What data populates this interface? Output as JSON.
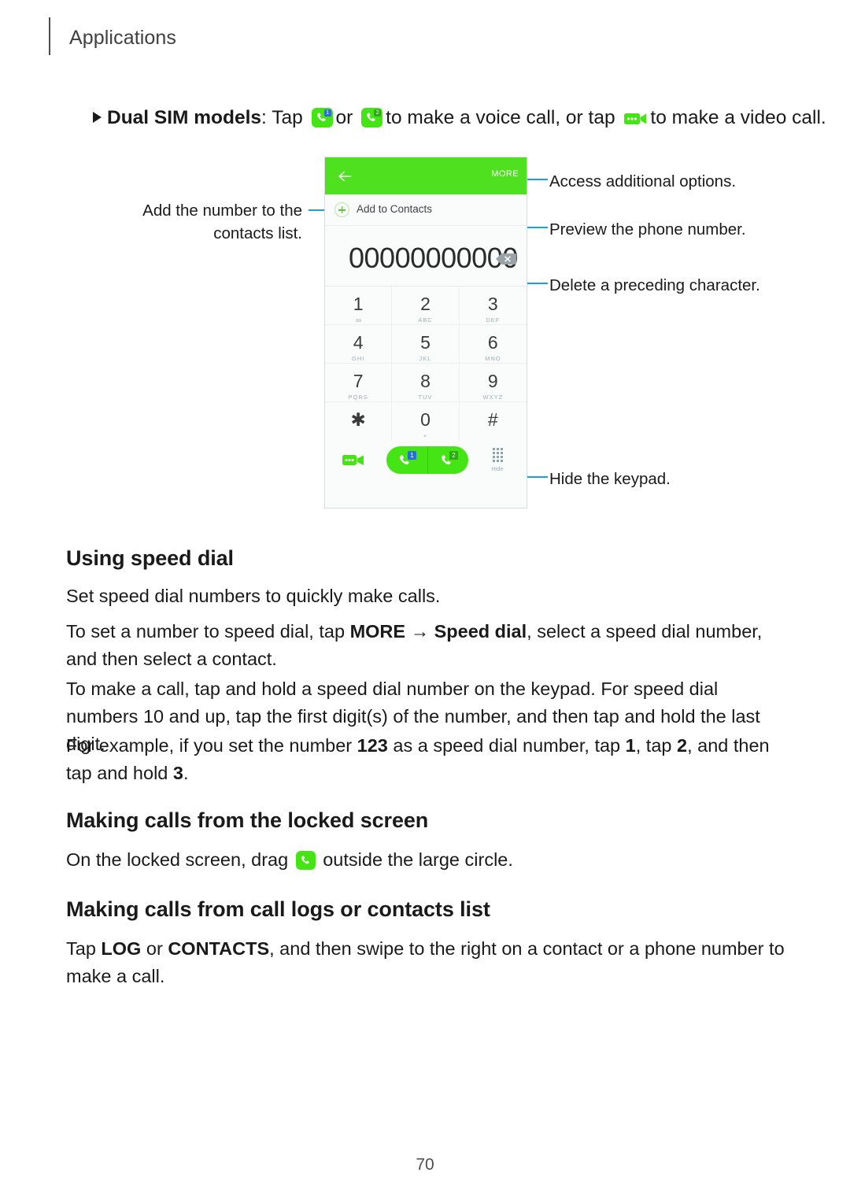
{
  "header": {
    "title": "Applications"
  },
  "bullet": {
    "marker": "▶",
    "lead_bold": "Dual SIM models",
    "part1": ": Tap",
    "part2": "or",
    "part3": "to make a voice call, or tap",
    "part4": "to make a video call.",
    "icons": [
      "phone-sim1-icon",
      "phone-sim2-icon",
      "video-call-icon"
    ]
  },
  "annotations": {
    "add_contacts": "Add the number to the contacts list.",
    "more": "Access additional options.",
    "preview": "Preview the phone number.",
    "delete": "Delete a preceding character.",
    "hide": "Hide the keypad.",
    "leader_color": "#1e9fd8"
  },
  "phone": {
    "accent_green": "#4fe01f",
    "topbar": {
      "back_icon": "arrow-left-icon",
      "more_label": "MORE"
    },
    "add_to_contacts": {
      "icon": "plus-circle-icon",
      "label": "Add to Contacts"
    },
    "number_field": {
      "value": "00000000000",
      "delete_icon": "backspace-icon"
    },
    "keypad": [
      {
        "digit": "1",
        "letters": "",
        "voicemail": "∞"
      },
      {
        "digit": "2",
        "letters": "ABC"
      },
      {
        "digit": "3",
        "letters": "DEF"
      },
      {
        "digit": "4",
        "letters": "GHI"
      },
      {
        "digit": "5",
        "letters": "JKL"
      },
      {
        "digit": "6",
        "letters": "MNO"
      },
      {
        "digit": "7",
        "letters": "PQRS"
      },
      {
        "digit": "8",
        "letters": "TUV"
      },
      {
        "digit": "9",
        "letters": "WXYZ"
      },
      {
        "digit": "✱",
        "letters": ""
      },
      {
        "digit": "0",
        "letters": "+"
      },
      {
        "digit": "#",
        "letters": ""
      }
    ],
    "actions": {
      "video_icon": "video-call-icon",
      "call_sim1_badge": "1",
      "call_sim2_badge": "2",
      "hide_icon": "keypad-grid-icon",
      "hide_label": "Hide"
    }
  },
  "sections": [
    {
      "heading": "Using speed dial",
      "paragraphs": [
        "Set speed dial numbers to quickly make calls.",
        "To set a number to speed dial, tap MORE → Speed dial, select a speed dial number, and then select a contact.",
        "To make a call, tap and hold a speed dial number on the keypad. For speed dial numbers 10 and up, tap the first digit(s) of the number, and then tap and hold the last digit.",
        "For example, if you set the number 123 as a speed dial number, tap 1, tap 2, and then tap and hold 3."
      ]
    },
    {
      "heading": "Making calls from the locked screen",
      "paragraphs": [
        "On the locked screen, drag   outside the large circle."
      ]
    },
    {
      "heading": "Making calls from call logs or contacts list",
      "paragraphs": [
        "Tap LOG or CONTACTS, and then swipe to the right on a contact or a phone number to make a call."
      ]
    }
  ],
  "page_number": "70"
}
